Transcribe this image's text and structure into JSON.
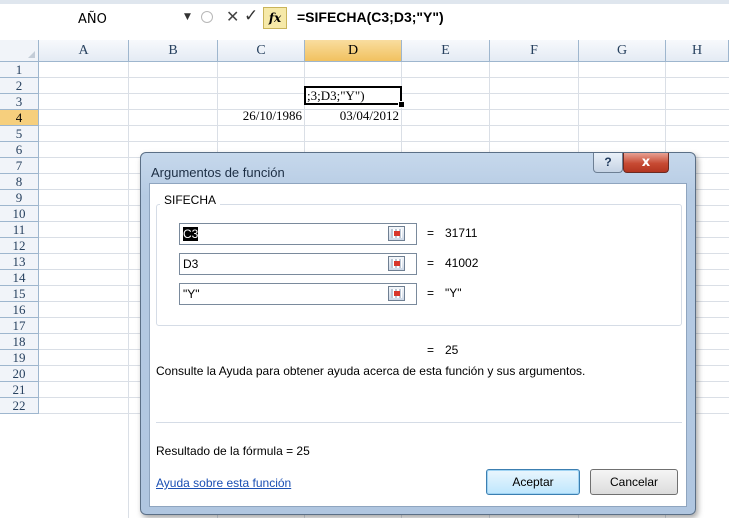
{
  "formula_bar": {
    "name_box": "AÑO",
    "cancel_symbol": "✕",
    "enter_symbol": "✓",
    "fx_label": "fx",
    "formula": "=SIFECHA(C3;D3;\"Y\")"
  },
  "sheet": {
    "columns": [
      "A",
      "B",
      "C",
      "D",
      "E",
      "F",
      "G",
      "H"
    ],
    "rows": [
      "1",
      "2",
      "3",
      "4",
      "5",
      "6",
      "7",
      "8",
      "9",
      "10",
      "11",
      "12",
      "13",
      "14",
      "15",
      "16",
      "17",
      "18",
      "19",
      "20",
      "21",
      "22"
    ],
    "selected_column": "D",
    "selected_row": "4",
    "cells": {
      "C3": "26/10/1986",
      "D3": "03/04/2012",
      "D4": ";3;D3;\"Y\")"
    }
  },
  "dialog": {
    "title": "Argumentos de función",
    "help_button": "?",
    "close_button": "x",
    "function_name": "SIFECHA",
    "arguments": [
      {
        "value_selected": "C3",
        "value_rest": "",
        "equals": "=",
        "result": "31711"
      },
      {
        "value_selected": "",
        "value_rest": "D3",
        "equals": "=",
        "result": "41002"
      },
      {
        "value_selected": "",
        "value_rest": "\"Y\"",
        "equals": "=",
        "result": "\"Y\""
      }
    ],
    "result_equals": "=",
    "result_value": "25",
    "description": "Consulte la Ayuda para obtener ayuda acerca de esta función y sus argumentos.",
    "formula_result": "Resultado de la fórmula =  25",
    "help_link": "Ayuda sobre esta función",
    "ok_button": "Aceptar",
    "cancel_button": "Cancelar"
  }
}
